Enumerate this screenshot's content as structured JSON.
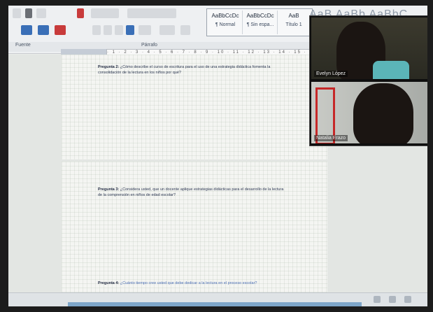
{
  "ribbon": {
    "font_group_label": "Fuente",
    "paragraph_group_label": "Párrafo",
    "styles": [
      {
        "sample": "AaBbCcDc",
        "name": "¶ Normal"
      },
      {
        "sample": "AaBbCcDc",
        "name": "¶ Sin espa..."
      },
      {
        "sample": "AaB",
        "name": "Título 1"
      }
    ],
    "styles_big": "AaB  AaBb  AaBbC"
  },
  "ruler": {
    "marks": "· 1 · 2 · 3 · 4 · 5 · 6 · 7 · 8 · 9 · 10 · 11 · 12 · 13 · 14 · 15 · 16"
  },
  "document": {
    "q2_label": "Pregunta 2:",
    "q2_text": "¿Cómo describe el curso de escritura para el uso de una estrategia didáctica fomenta la consolidación de la lectura en los niños por qué?",
    "q3_label": "Pregunta 3:",
    "q3_text": "¿Considera usted, que un docente aplique estrategias didácticas para el desarrollo de la lectura de la comprensión en niños de edad escolar?",
    "q4_label": "Pregunta 4:",
    "q4_text": "¿Cuánto tiempo cree usted que debe dedicar a la lectura en el proceso escolar?"
  },
  "video": {
    "participant1": "Evelyn López",
    "participant2": "Natalia Erazo"
  },
  "colors": {
    "accent": "#3a6fb7",
    "video_bg": "#0f0f0f",
    "door_red": "#c62828"
  }
}
